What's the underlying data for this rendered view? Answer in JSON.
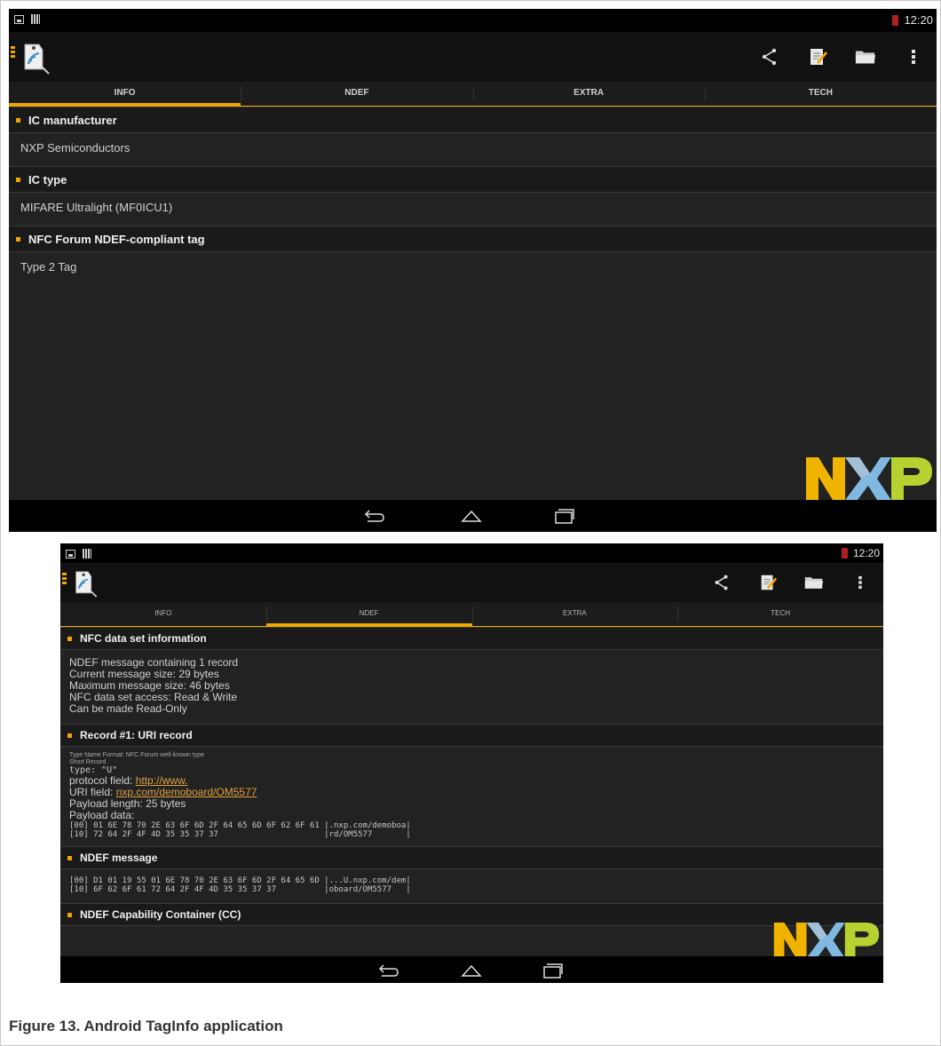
{
  "screen1": {
    "status": {
      "time": "12:20"
    },
    "tabs": [
      "INFO",
      "NDEF",
      "EXTRA",
      "TECH"
    ],
    "active_tab": "INFO",
    "sections": [
      {
        "title": "IC manufacturer",
        "value": "NXP Semiconductors"
      },
      {
        "title": "IC type",
        "value": "MIFARE Ultralight (MF0ICU1)"
      },
      {
        "title": "NFC Forum NDEF-compliant tag",
        "value": "Type 2 Tag"
      }
    ]
  },
  "screen2": {
    "status": {
      "time": "12:20"
    },
    "tabs": [
      "INFO",
      "NDEF",
      "EXTRA",
      "TECH"
    ],
    "active_tab": "NDEF",
    "nfc_data_set": {
      "title": "NFC data set information",
      "lines": [
        "NDEF message containing 1 record",
        "Current message size: 29 bytes",
        "Maximum message size: 46 bytes",
        "NFC data set access: Read & Write",
        "Can be made Read-Only"
      ]
    },
    "record": {
      "title": "Record #1: URI record",
      "tnf": "Type Name Format: NFC Forum well-known type",
      "short_record": "Short Record",
      "type": "type: \"U\"",
      "protocol_label": "protocol field:",
      "protocol_value": "http://www.",
      "uri_label": "URI field:",
      "uri_value": "nxp.com/demoboard/OM5577",
      "payload_length": "Payload length: 25 bytes",
      "payload_label": "Payload data:",
      "payload_hex": [
        "[00] 01 6E 78 70 2E 63 6F 6D 2F 64 65 6D 6F 62 6F 61 |.nxp.com/demoboa|",
        "[10] 72 64 2F 4F 4D 35 35 37 37                      |rd/OM5577       |"
      ]
    },
    "ndef_message": {
      "title": "NDEF message",
      "hex": [
        "[00] D1 01 19 55 01 6E 78 70 2E 63 6F 6D 2F 64 65 6D |...U.nxp.com/dem|",
        "[10] 6F 62 6F 61 72 64 2F 4F 4D 35 35 37 37          |oboard/OM5577   |"
      ]
    },
    "cc": {
      "title": "NDEF Capability Container (CC)"
    }
  },
  "caption": "Figure 13.  Android TagInfo application",
  "colors": {
    "accent": "#f0a500",
    "background": "#222222",
    "link": "#e0a040"
  },
  "icons": [
    "share-icon",
    "edit-icon",
    "folder-icon",
    "overflow-menu-icon",
    "back-icon",
    "home-icon",
    "recents-icon"
  ]
}
